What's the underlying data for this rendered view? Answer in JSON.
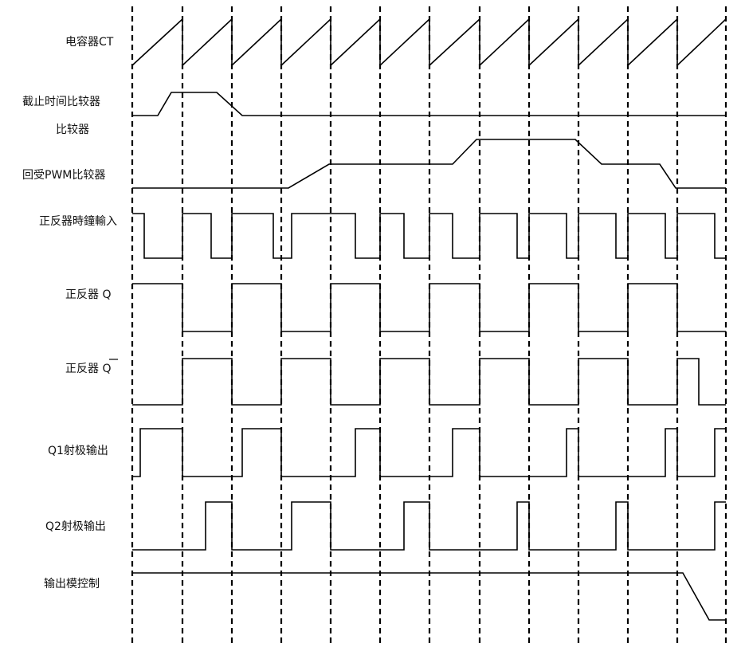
{
  "labels": {
    "capacitor": "电容器CT",
    "deadtime": "截止时间比较器",
    "comparator": "比较器",
    "pwm": "回受PWM比较器",
    "clock": "正反器時鐘輸入",
    "q": "正反器 Q",
    "qbar": "正反器 Q",
    "q1": "Q1射极输出",
    "q2": "Q2射极输出",
    "outctrl": "输出模控制"
  }
}
